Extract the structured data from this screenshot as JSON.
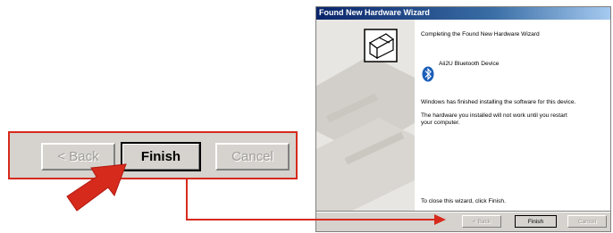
{
  "zoom": {
    "back_label": "< Back",
    "finish_label": "Finish",
    "cancel_label": "Cancel"
  },
  "wizard": {
    "title": "Found New Hardware Wizard",
    "heading": "Completing the Found New Hardware Wizard",
    "device_name": "Aii2U Bluetooth Device",
    "msg_finished": "Windows has finished installing the software for this device.",
    "msg_restart_line1": "The hardware you installed will not work until you restart",
    "msg_restart_line2": "your computer.",
    "msg_close": "To close this wizard, click Finish.",
    "back_label": "< Back",
    "finish_label": "Finish",
    "cancel_label": "Cancel"
  },
  "colors": {
    "callout_red": "#d62a1c",
    "title_blue": "#0a246a",
    "bluetooth_blue": "#1c5fb8"
  }
}
